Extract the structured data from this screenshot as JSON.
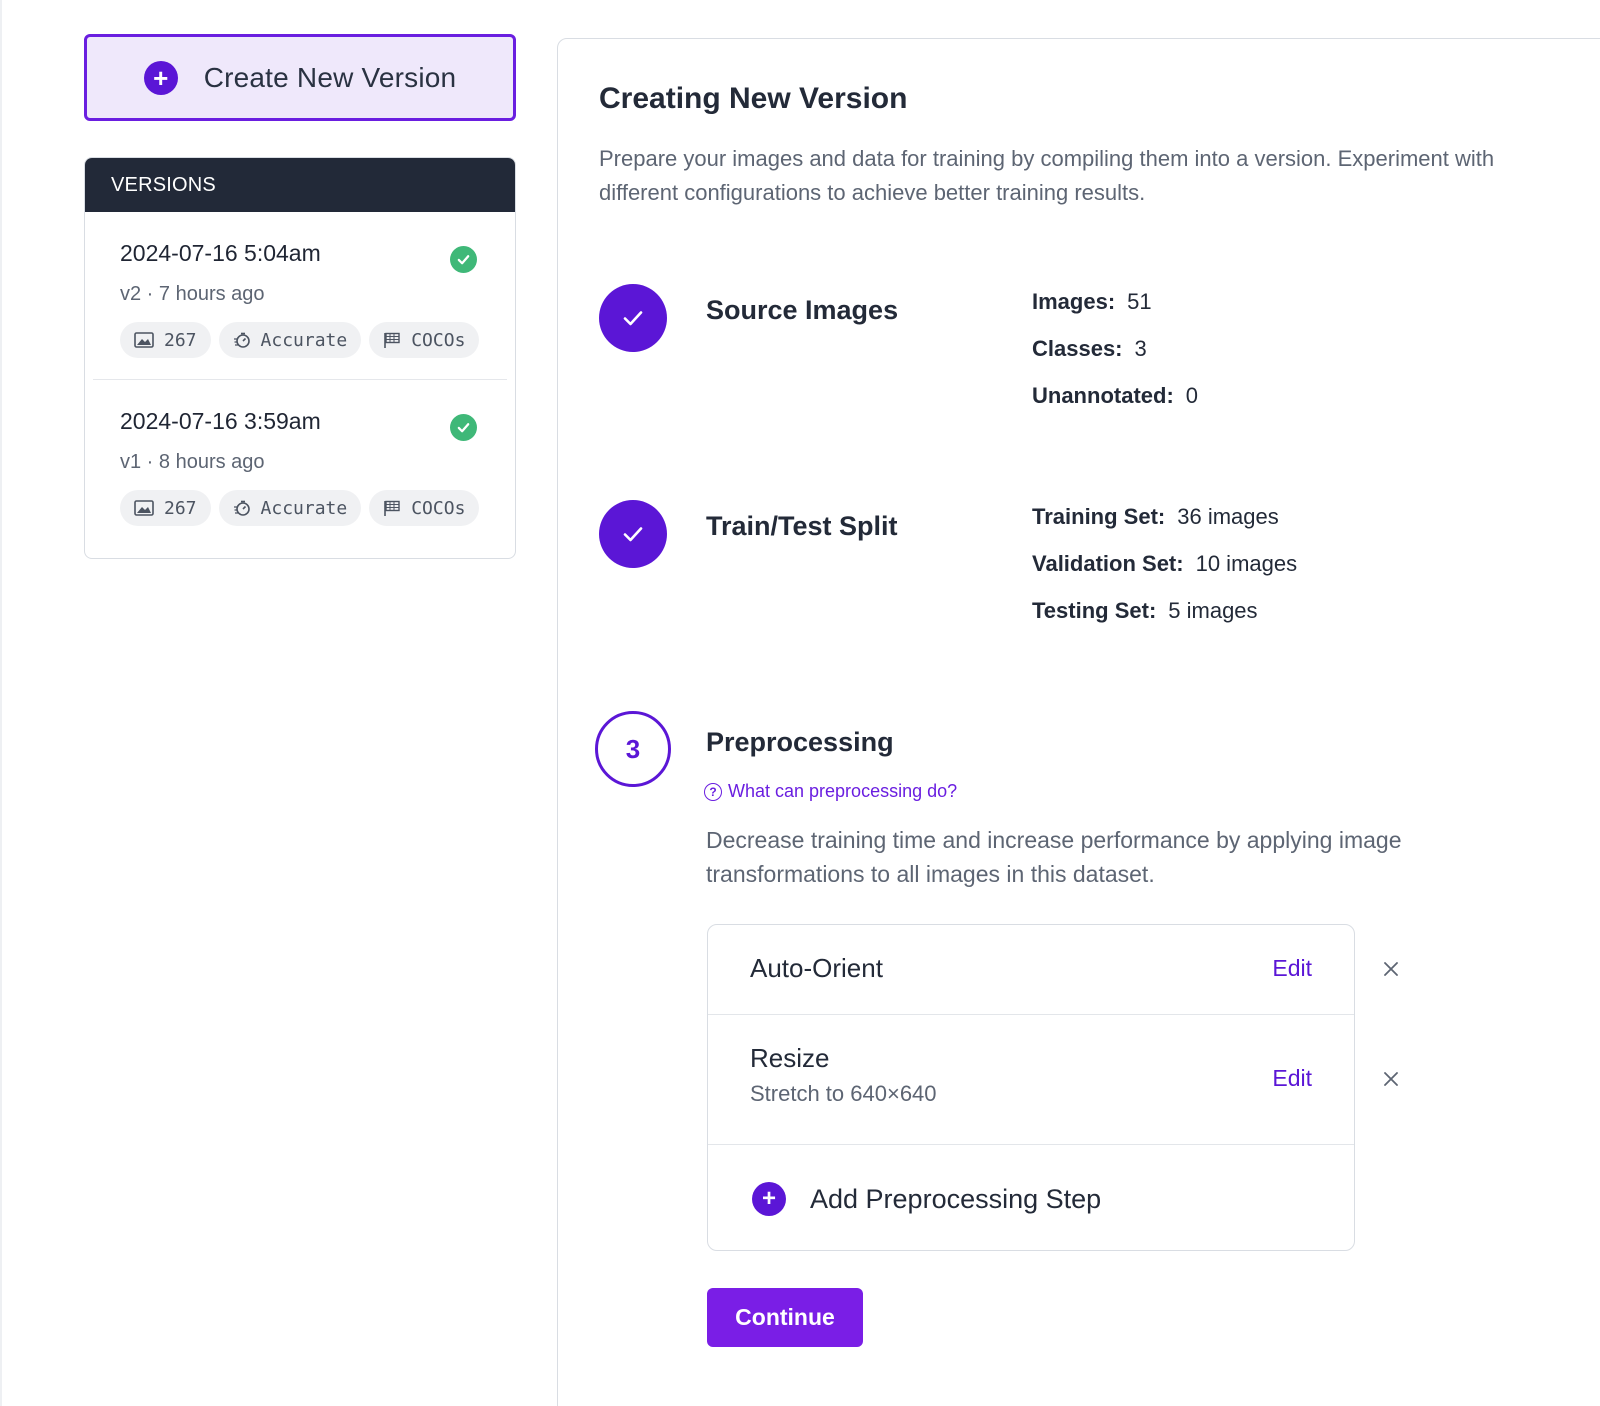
{
  "sidebar": {
    "create_button_label": "Create New Version",
    "versions_header": "VERSIONS",
    "versions": [
      {
        "date": "2024-07-16 5:04am",
        "meta": "v2 · 7 hours ago",
        "status": "success",
        "tags": {
          "images": "267",
          "speed": "Accurate",
          "format": "COCOs"
        }
      },
      {
        "date": "2024-07-16 3:59am",
        "meta": "v1 · 8 hours ago",
        "status": "success",
        "tags": {
          "images": "267",
          "speed": "Accurate",
          "format": "COCOs"
        }
      }
    ]
  },
  "main": {
    "title": "Creating New Version",
    "description": "Prepare your images and data for training by compiling them into a version. Experiment with different configurations to achieve better training results.",
    "steps": {
      "source": {
        "title": "Source Images",
        "stats": [
          {
            "label": "Images:",
            "value": "51"
          },
          {
            "label": "Classes:",
            "value": "3"
          },
          {
            "label": "Unannotated:",
            "value": "0"
          }
        ]
      },
      "split": {
        "title": "Train/Test Split",
        "stats": [
          {
            "label": "Training Set:",
            "value": "36 images"
          },
          {
            "label": "Validation Set:",
            "value": "10 images"
          },
          {
            "label": "Testing Set:",
            "value": "5 images"
          }
        ]
      },
      "preprocessing": {
        "number": "3",
        "title": "Preprocessing",
        "help_link": "What can preprocessing do?",
        "description": "Decrease training time and increase performance by applying image transformations to all images in this dataset.",
        "items": [
          {
            "name": "Auto-Orient",
            "detail": "",
            "edit_label": "Edit"
          },
          {
            "name": "Resize",
            "detail": "Stretch to 640×640",
            "edit_label": "Edit"
          }
        ],
        "add_step_label": "Add Preprocessing Step",
        "continue_label": "Continue"
      }
    }
  },
  "colors": {
    "accent": "#5b16d6",
    "accent_light": "#efe8fb",
    "success": "#3fb878",
    "header_dark": "#222938"
  }
}
